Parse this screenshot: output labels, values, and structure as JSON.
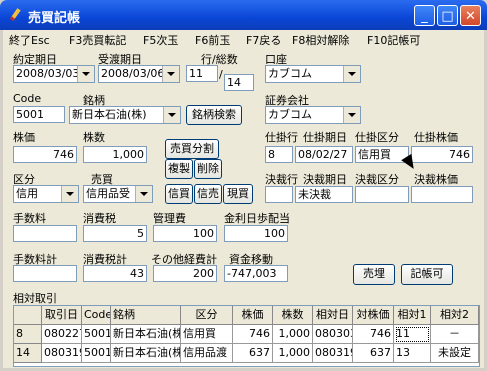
{
  "window": {
    "title": "売買記帳"
  },
  "menu": [
    "終了Esc",
    "F3売買転記",
    "F5次玉",
    "F6前玉",
    "F7戻る",
    "F8相対解除",
    "F10記帳可"
  ],
  "form": {
    "settle_date_label": "約定期日",
    "settle_date": "2008/03/03",
    "delivery_date_label": "受渡期日",
    "delivery_date": "2008/03/06",
    "row_total_label": "行/総数",
    "row": "11",
    "total": "14",
    "account_label": "口座",
    "account": "カブコム",
    "code_label": "Code",
    "code": "5001",
    "brand_label": "銘柄",
    "brand": "新日本石油(株)",
    "brand_search_label": "銘柄検索",
    "broker_label": "証券会社",
    "broker": "カブコム",
    "price_label": "株価",
    "price": "746",
    "shares_label": "株数",
    "shares": "1,000",
    "split_label": "売買分割",
    "copy_label": "複製",
    "delete_label": "削除",
    "kubun_label": "区分",
    "kubun": "信用",
    "baibai_label": "売買",
    "baibai": "信用品受",
    "shinbai_label": "信買",
    "shinbai2_label": "信売",
    "genbai_label": "現買",
    "open_row_label": "仕掛行",
    "open_date_label": "仕掛期日",
    "open_kubun_label": "仕掛区分",
    "open_price_label": "仕掛株価",
    "open_row": "8",
    "open_date": "08/02/27",
    "open_kubun": "信用買",
    "open_price": "746",
    "settle_row_label": "決裁行",
    "settle_date2_label": "決裁期日",
    "settle_kubun_label": "決裁区分",
    "settle_price_label": "決裁株価",
    "settle_row": "",
    "settle_date2": "未決裁",
    "settle_kubun": "",
    "settle_price": "",
    "fee_label": "手数料",
    "fee": "",
    "tax_label": "消費税",
    "tax": "5",
    "mgmt_label": "管理費",
    "mgmt": "100",
    "interest_label": "金利日歩配当",
    "interest": "100",
    "fee_total_label": "手数料計",
    "fee_total": "",
    "tax_total_label": "消費税計",
    "tax_total": "43",
    "other_total_label": "その他経費計",
    "other_total": "200",
    "cash_move_label": "資金移動",
    "cash_move": "-747,003",
    "sell_button": "売埋",
    "record_button": "記帳可"
  },
  "grid": {
    "title": "相対取引",
    "headers": [
      "",
      "取引日",
      "Code",
      "銘柄",
      "区分",
      "株価",
      "株数",
      "相対日",
      "対株価",
      "相対1",
      "相対2"
    ],
    "rows": [
      [
        "8",
        "080227",
        "5001",
        "新日本石油(株)",
        "信用買",
        "746",
        "1,000",
        "080303",
        "746",
        "11",
        "－"
      ],
      [
        "14",
        "080319",
        "5001",
        "新日本石油(株)",
        "信用品渡",
        "637",
        "1,000",
        "080319",
        "637",
        "13",
        "未設定"
      ]
    ]
  }
}
